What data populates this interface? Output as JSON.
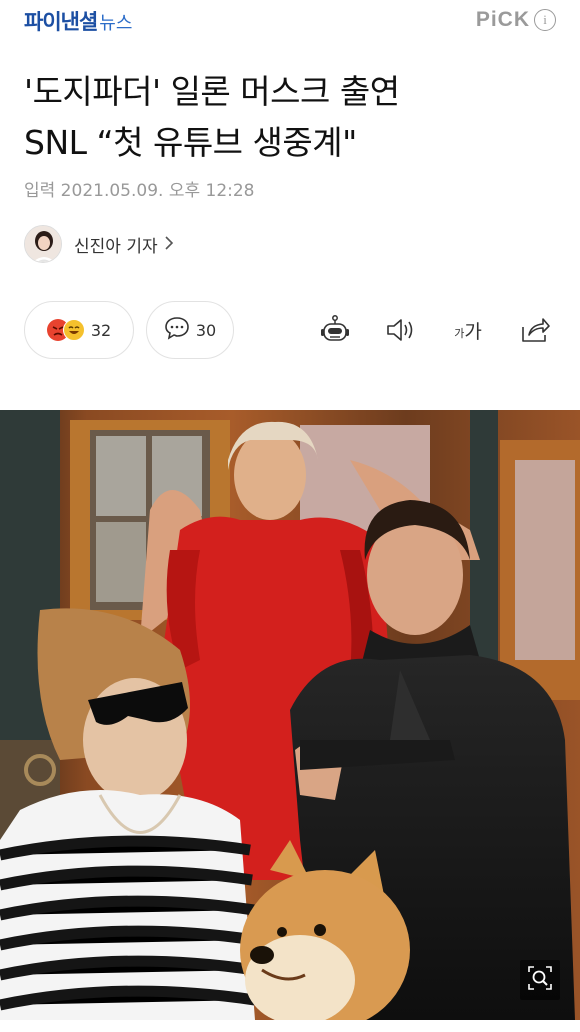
{
  "header": {
    "logo_main": "파이낸셜",
    "logo_sub": "뉴스",
    "pick_label": "PiCK",
    "info_glyph": "i"
  },
  "article": {
    "headline_line1": "'도지파더' 일론 머스크 출연",
    "headline_line2": "SNL “첫 유튜브 생중계\"",
    "dateline": "입력 2021.05.09. 오후 12:28",
    "reporter": "신진아 기자"
  },
  "actions": {
    "reaction_count": "32",
    "comment_count": "30",
    "icons": [
      "reaction-emoji-icon",
      "comment-icon",
      "robot-summary-icon",
      "speaker-icon",
      "font-size-icon",
      "share-icon"
    ],
    "font_size_label_small": "가",
    "font_size_label_large": "가"
  },
  "photo": {
    "alt": "SNL cast photo with dog"
  },
  "colors": {
    "brand_blue": "#1c4fa3",
    "muted_gray": "#999999",
    "angry_red": "#e8432f",
    "laugh_yellow": "#f5c12d"
  }
}
